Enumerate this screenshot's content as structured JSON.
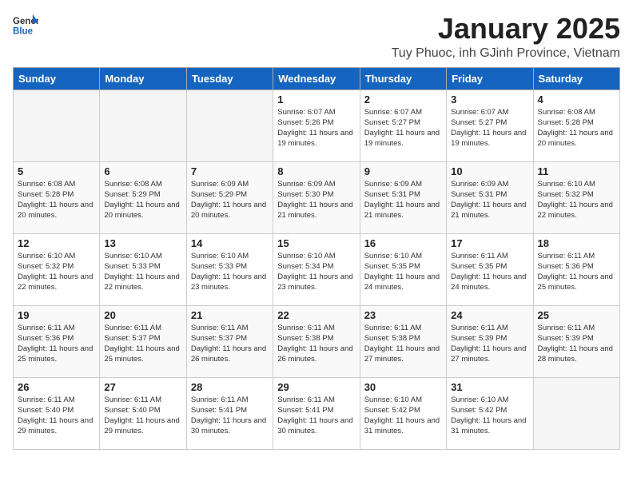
{
  "header": {
    "logo_general": "General",
    "logo_blue": "Blue",
    "title": "January 2025",
    "subtitle": "Tuy Phuoc, inh GJinh Province, Vietnam"
  },
  "weekdays": [
    "Sunday",
    "Monday",
    "Tuesday",
    "Wednesday",
    "Thursday",
    "Friday",
    "Saturday"
  ],
  "weeks": [
    [
      {
        "day": "",
        "empty": true
      },
      {
        "day": "",
        "empty": true
      },
      {
        "day": "",
        "empty": true
      },
      {
        "day": "1",
        "sunrise": "6:07 AM",
        "sunset": "5:26 PM",
        "daylight": "11 hours and 19 minutes."
      },
      {
        "day": "2",
        "sunrise": "6:07 AM",
        "sunset": "5:27 PM",
        "daylight": "11 hours and 19 minutes."
      },
      {
        "day": "3",
        "sunrise": "6:07 AM",
        "sunset": "5:27 PM",
        "daylight": "11 hours and 19 minutes."
      },
      {
        "day": "4",
        "sunrise": "6:08 AM",
        "sunset": "5:28 PM",
        "daylight": "11 hours and 20 minutes."
      }
    ],
    [
      {
        "day": "5",
        "sunrise": "6:08 AM",
        "sunset": "5:28 PM",
        "daylight": "11 hours and 20 minutes."
      },
      {
        "day": "6",
        "sunrise": "6:08 AM",
        "sunset": "5:29 PM",
        "daylight": "11 hours and 20 minutes."
      },
      {
        "day": "7",
        "sunrise": "6:09 AM",
        "sunset": "5:29 PM",
        "daylight": "11 hours and 20 minutes."
      },
      {
        "day": "8",
        "sunrise": "6:09 AM",
        "sunset": "5:30 PM",
        "daylight": "11 hours and 21 minutes."
      },
      {
        "day": "9",
        "sunrise": "6:09 AM",
        "sunset": "5:31 PM",
        "daylight": "11 hours and 21 minutes."
      },
      {
        "day": "10",
        "sunrise": "6:09 AM",
        "sunset": "5:31 PM",
        "daylight": "11 hours and 21 minutes."
      },
      {
        "day": "11",
        "sunrise": "6:10 AM",
        "sunset": "5:32 PM",
        "daylight": "11 hours and 22 minutes."
      }
    ],
    [
      {
        "day": "12",
        "sunrise": "6:10 AM",
        "sunset": "5:32 PM",
        "daylight": "11 hours and 22 minutes."
      },
      {
        "day": "13",
        "sunrise": "6:10 AM",
        "sunset": "5:33 PM",
        "daylight": "11 hours and 22 minutes."
      },
      {
        "day": "14",
        "sunrise": "6:10 AM",
        "sunset": "5:33 PM",
        "daylight": "11 hours and 23 minutes."
      },
      {
        "day": "15",
        "sunrise": "6:10 AM",
        "sunset": "5:34 PM",
        "daylight": "11 hours and 23 minutes."
      },
      {
        "day": "16",
        "sunrise": "6:10 AM",
        "sunset": "5:35 PM",
        "daylight": "11 hours and 24 minutes."
      },
      {
        "day": "17",
        "sunrise": "6:11 AM",
        "sunset": "5:35 PM",
        "daylight": "11 hours and 24 minutes."
      },
      {
        "day": "18",
        "sunrise": "6:11 AM",
        "sunset": "5:36 PM",
        "daylight": "11 hours and 25 minutes."
      }
    ],
    [
      {
        "day": "19",
        "sunrise": "6:11 AM",
        "sunset": "5:36 PM",
        "daylight": "11 hours and 25 minutes."
      },
      {
        "day": "20",
        "sunrise": "6:11 AM",
        "sunset": "5:37 PM",
        "daylight": "11 hours and 25 minutes."
      },
      {
        "day": "21",
        "sunrise": "6:11 AM",
        "sunset": "5:37 PM",
        "daylight": "11 hours and 26 minutes."
      },
      {
        "day": "22",
        "sunrise": "6:11 AM",
        "sunset": "5:38 PM",
        "daylight": "11 hours and 26 minutes."
      },
      {
        "day": "23",
        "sunrise": "6:11 AM",
        "sunset": "5:38 PM",
        "daylight": "11 hours and 27 minutes."
      },
      {
        "day": "24",
        "sunrise": "6:11 AM",
        "sunset": "5:39 PM",
        "daylight": "11 hours and 27 minutes."
      },
      {
        "day": "25",
        "sunrise": "6:11 AM",
        "sunset": "5:39 PM",
        "daylight": "11 hours and 28 minutes."
      }
    ],
    [
      {
        "day": "26",
        "sunrise": "6:11 AM",
        "sunset": "5:40 PM",
        "daylight": "11 hours and 29 minutes."
      },
      {
        "day": "27",
        "sunrise": "6:11 AM",
        "sunset": "5:40 PM",
        "daylight": "11 hours and 29 minutes."
      },
      {
        "day": "28",
        "sunrise": "6:11 AM",
        "sunset": "5:41 PM",
        "daylight": "11 hours and 30 minutes."
      },
      {
        "day": "29",
        "sunrise": "6:11 AM",
        "sunset": "5:41 PM",
        "daylight": "11 hours and 30 minutes."
      },
      {
        "day": "30",
        "sunrise": "6:10 AM",
        "sunset": "5:42 PM",
        "daylight": "11 hours and 31 minutes."
      },
      {
        "day": "31",
        "sunrise": "6:10 AM",
        "sunset": "5:42 PM",
        "daylight": "11 hours and 31 minutes."
      },
      {
        "day": "",
        "empty": true
      }
    ]
  ],
  "labels": {
    "sunrise": "Sunrise:",
    "sunset": "Sunset:",
    "daylight": "Daylight:"
  }
}
